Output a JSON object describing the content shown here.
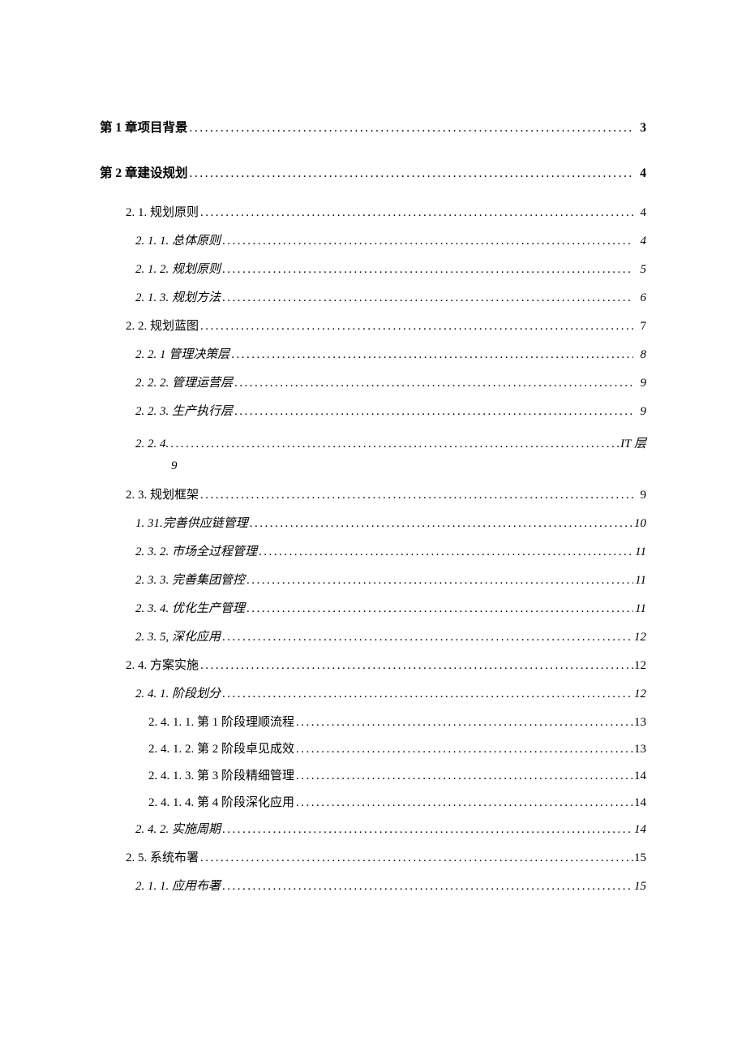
{
  "toc": {
    "entries": [
      {
        "label": "第 1 章项目背景",
        "page": "3",
        "level": 0,
        "italic": false,
        "cls": "first-chapter"
      },
      {
        "label": "第 2 章建设规划",
        "page": "4",
        "level": 0,
        "italic": false,
        "cls": "second-chapter"
      },
      {
        "label": "2. 1. 规划原则 ",
        "page": "4",
        "level": 1,
        "italic": false
      },
      {
        "label": "2. 1. 1. 总体原则 ",
        "page": "4",
        "level": 2,
        "italic": true
      },
      {
        "label": "2. 1. 2. 规划原则 ",
        "page": "5",
        "level": 2,
        "italic": true
      },
      {
        "label": "2. 1. 3. 规划方法 ",
        "page": "6",
        "level": 2,
        "italic": true
      },
      {
        "label": "2. 2. 规划蓝图 ",
        "page": "7",
        "level": 1,
        "italic": false
      },
      {
        "label": "2. 2.  1 管理决策层",
        "page": "8",
        "level": 2,
        "italic": true
      },
      {
        "label": "2. 2.  2. 管理运营层 ",
        "page": "9",
        "level": 2,
        "italic": true
      },
      {
        "label": "2. 2.  3. 生产执行层 ",
        "page": "9",
        "level": 2,
        "italic": true
      },
      {
        "special": "224",
        "label_left": "2. 2.  4.  ",
        "label_right": " IT 层",
        "page_below": "9",
        "level": 2,
        "italic": true
      },
      {
        "label": "2.  3. 规划框架 ",
        "page": "9",
        "level": 1,
        "italic": false
      },
      {
        "label": "1.  31.完善供应链管理 ",
        "page": "10",
        "level": 2,
        "italic": true
      },
      {
        "label": "2.  3. 2. 市场全过程管理 ",
        "page": "11",
        "level": 2,
        "italic": true
      },
      {
        "label": "2. 3. 3. 完善集团管控",
        "page": "11",
        "level": 2,
        "italic": true
      },
      {
        "label": "2. 3. 4. 优化生产管理",
        "page": "11",
        "level": 2,
        "italic": true
      },
      {
        "label": "2. 3. 5, 深化应用",
        "page": "12",
        "level": 2,
        "italic": true
      },
      {
        "label": "2. 4. 方案实施",
        "page": " 12",
        "level": 1,
        "italic": false
      },
      {
        "label": "2. 4. 1. 阶段划分",
        "page": "12",
        "level": 2,
        "italic": true
      },
      {
        "label": "2. 4. 1. 1. 第 1 阶段理顺流程 ",
        "page": "13",
        "level": 3,
        "italic": false
      },
      {
        "label": "2. 4. 1. 2. 第 2 阶段卓见成效 ",
        "page": " 13",
        "level": 3,
        "italic": false
      },
      {
        "label": "2. 4. 1. 3. 第 3 阶段精细管理 ",
        "page": "14",
        "level": 3,
        "italic": false
      },
      {
        "label": "2. 4. 1. 4. 第 4 阶段深化应用 ",
        "page": "14",
        "level": 3,
        "italic": false
      },
      {
        "label": "2. 4. 2. 实施周期",
        "page": "14",
        "level": 2,
        "italic": true
      },
      {
        "label": "2.  5. 系统布署",
        "page": "15",
        "level": 1,
        "italic": false
      },
      {
        "label": "2. 1. 1.  应用布署",
        "page": "15",
        "level": 2,
        "italic": true
      }
    ]
  }
}
